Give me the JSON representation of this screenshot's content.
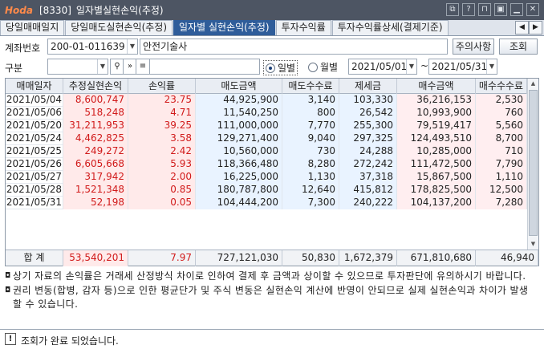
{
  "window": {
    "brand": "Hoda",
    "screen_code": "[8330]",
    "title": "일자별실현손익(추정)"
  },
  "tabs": [
    {
      "label": "당일매매일지",
      "active": false
    },
    {
      "label": "당일매도실현손익(추정)",
      "active": false
    },
    {
      "label": "일자별 실현손익(추정)",
      "active": true
    },
    {
      "label": "투자수익률",
      "active": false
    },
    {
      "label": "투자수익률상세(결제기준)",
      "active": false
    }
  ],
  "form": {
    "account_label": "계좌번호",
    "account_number": "200-01-011639",
    "account_name": "안전기술사",
    "caution_button": "주의사항",
    "query_button": "조회",
    "category_label": "구분",
    "category_value": "",
    "search_value": "",
    "radio_daily": "일별",
    "radio_monthly": "월별",
    "selected_period": "daily",
    "date_from": "2021/05/01",
    "date_sep": "~",
    "date_to": "2021/05/31"
  },
  "table": {
    "headers": [
      "매매일자",
      "추정실현손익",
      "손익률",
      "매도금액",
      "매도수수료",
      "제세금",
      "매수금액",
      "매수수수료"
    ],
    "rows": [
      [
        "2021/05/04",
        "8,600,747",
        "23.75",
        "44,925,900",
        "3,140",
        "103,330",
        "36,216,153",
        "2,530"
      ],
      [
        "2021/05/06",
        "518,248",
        "4.71",
        "11,540,250",
        "800",
        "26,542",
        "10,993,900",
        "760"
      ],
      [
        "2021/05/20",
        "31,211,953",
        "39.25",
        "111,000,000",
        "7,770",
        "255,300",
        "79,519,417",
        "5,560"
      ],
      [
        "2021/05/24",
        "4,462,825",
        "3.58",
        "129,271,400",
        "9,040",
        "297,325",
        "124,493,510",
        "8,700"
      ],
      [
        "2021/05/25",
        "249,272",
        "2.42",
        "10,560,000",
        "730",
        "24,288",
        "10,285,000",
        "710"
      ],
      [
        "2021/05/26",
        "6,605,668",
        "5.93",
        "118,366,480",
        "8,280",
        "272,242",
        "111,472,500",
        "7,790"
      ],
      [
        "2021/05/27",
        "317,942",
        "2.00",
        "16,225,000",
        "1,130",
        "37,318",
        "15,867,500",
        "1,110"
      ],
      [
        "2021/05/28",
        "1,521,348",
        "0.85",
        "180,787,800",
        "12,640",
        "415,812",
        "178,825,500",
        "12,500"
      ],
      [
        "2021/05/31",
        "52,198",
        "0.05",
        "104,444,200",
        "7,300",
        "240,222",
        "104,137,200",
        "7,280"
      ]
    ],
    "total": {
      "label": "합 계",
      "values": [
        "53,540,201",
        "7.97",
        "727,121,030",
        "50,830",
        "1,672,379",
        "671,810,680",
        "46,940"
      ]
    }
  },
  "notes": [
    "상기 자료의 손익률은 거래세 산정방식 차이로 인하여 결제 후 금액과 상이할 수 있으므로 투자판단에 유의하시기 바랍니다.",
    "권리 변동(합병, 감자 등)으로 인한 평균단가 및 주식 변동은 실현손익 계산에 반영이 안되므로 실제 실현손익과 차이가 발생할 수 있습니다."
  ],
  "status": {
    "message": "조회가 완료 되었습니다."
  },
  "colors": {
    "titlebar": "#4d5563",
    "active_tab": "#2f5d9a",
    "profit_text": "#d11a1a",
    "profit_bg": "#ffeaea",
    "sell_bg": "#e9f3ff",
    "buy_bg": "#ffeef0"
  },
  "icons": [
    "window-restore-icon",
    "help-icon",
    "pin-icon",
    "save-icon",
    "minimize-icon",
    "close-icon",
    "search-icon",
    "next-icon",
    "calendar-icon",
    "warning-icon"
  ]
}
